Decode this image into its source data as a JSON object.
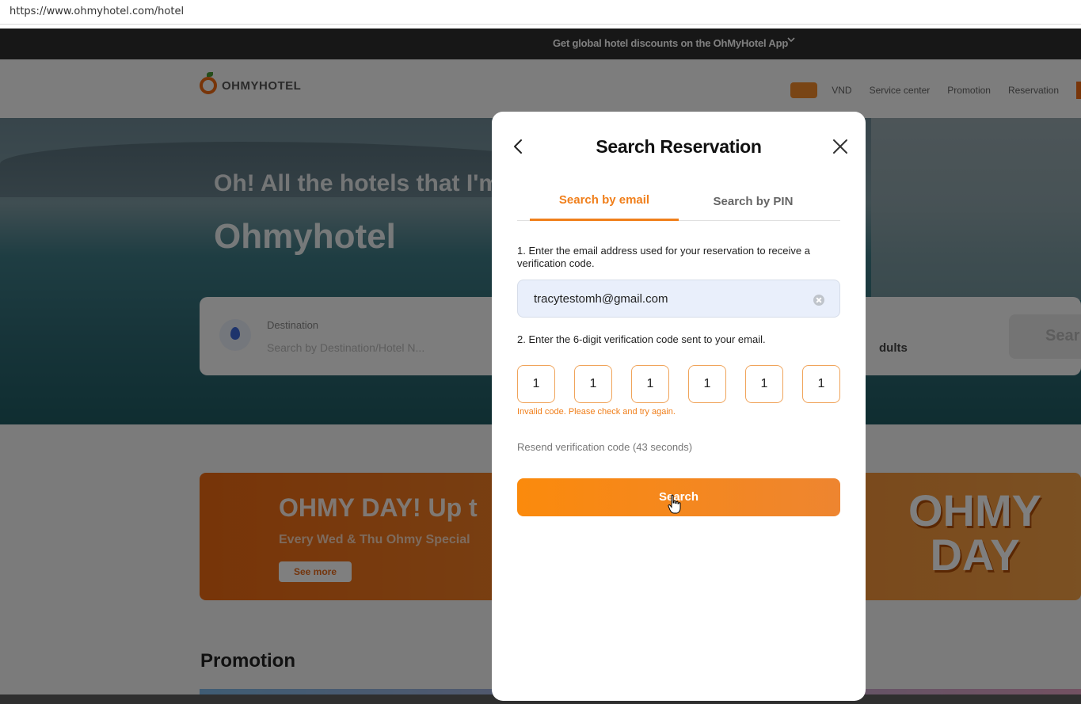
{
  "browser": {
    "url": "https://www.ohmyhotel.com/hotel"
  },
  "promo_bar": {
    "text": "Get global hotel discounts on the OhMyHotel App"
  },
  "header": {
    "logo_text": "OHMYHOTEL",
    "currency": "VND",
    "nav": [
      "Service center",
      "Promotion",
      "Reservation"
    ]
  },
  "hero": {
    "headline": "Oh! All the hotels that I'm",
    "brand": "Ohmyhotel",
    "search": {
      "destination_label": "Destination",
      "destination_placeholder": "Search by Destination/Hotel N...",
      "guests_value": "dults",
      "search_button": "Sear"
    }
  },
  "banner": {
    "title": "OHMY DAY! Up t",
    "subtitle": "Every Wed & Thu Ohmy Special",
    "button": "See more",
    "art_line1": "OHMY",
    "art_line2": "DAY"
  },
  "section": {
    "promotion_title": "Promotion"
  },
  "modal": {
    "title": "Search Reservation",
    "tabs": [
      {
        "label": "Search by email",
        "active": true
      },
      {
        "label": "Search by PIN",
        "active": false
      }
    ],
    "step1": "1. Enter the email address used for your reservation to receive a verification code.",
    "email_value": "tracytestomh@gmail.com",
    "step2": "2. Enter the 6-digit verification code sent to your email.",
    "code_digits": [
      "1",
      "1",
      "1",
      "1",
      "1",
      "1"
    ],
    "error": "Invalid code. Please check and try again.",
    "resend": "Resend verification code (43  seconds)",
    "search_button": "Search"
  },
  "colors": {
    "accent": "#f07f1b",
    "promo_bar": "#2f2f2f",
    "input_bg": "#e9effb"
  }
}
